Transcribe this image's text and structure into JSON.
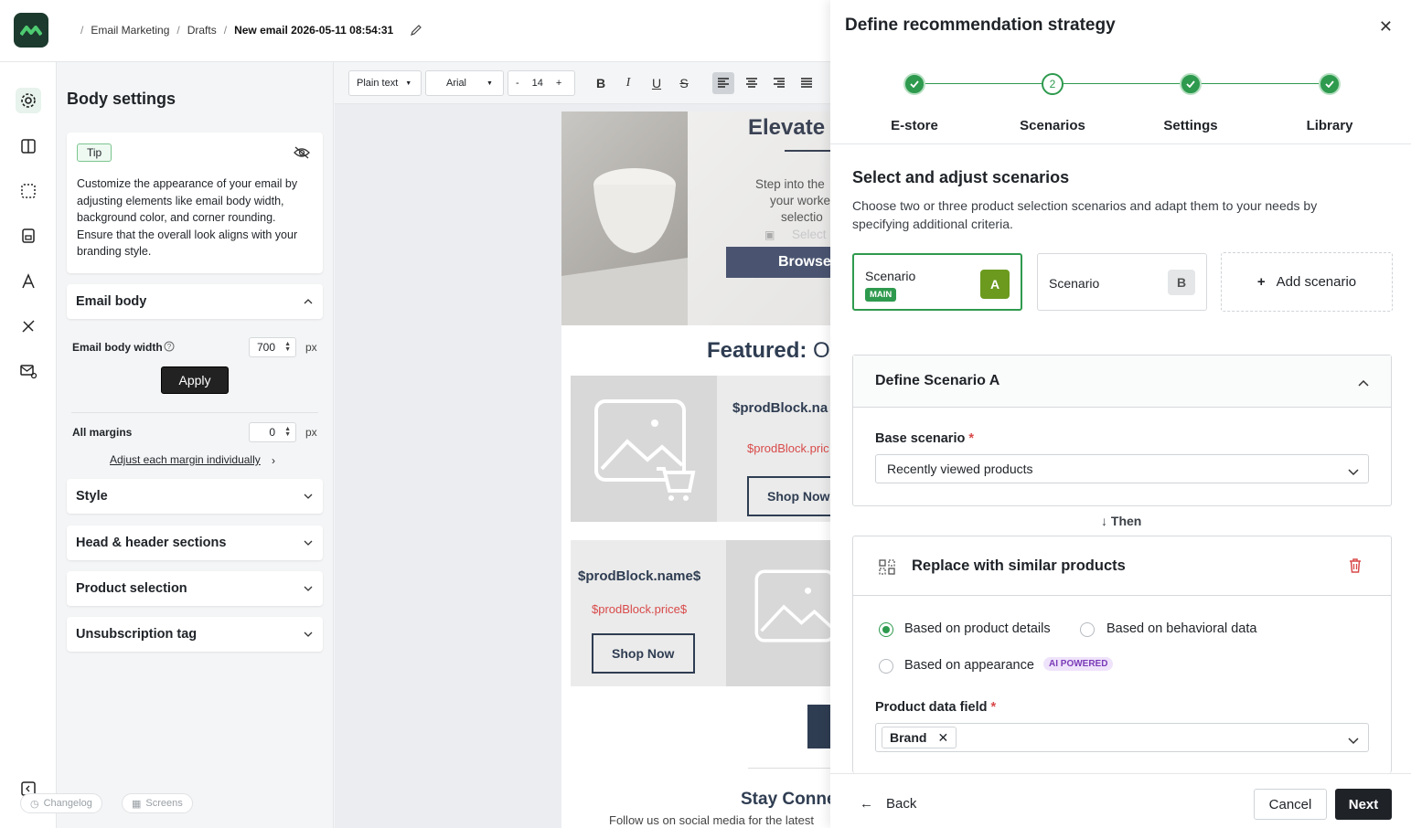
{
  "breadcrumb": {
    "root": "Email Marketing",
    "folder": "Drafts",
    "current": "New email 2026-05-11 08:54:31"
  },
  "settings": {
    "title": "Body settings",
    "tip_badge": "Tip",
    "tip_text": "Customize the appearance of your email by adjusting elements like email body width, background color, and corner rounding. Ensure that the overall look aligns with your branding style.",
    "email_body": "Email body",
    "email_body_width_label": "Email body width",
    "email_body_width_value": "700",
    "unit": "px",
    "apply": "Apply",
    "all_margins_label": "All margins",
    "all_margins_value": "0",
    "adjust_link": "Adjust each margin individually",
    "sections": [
      "Style",
      "Head & header sections",
      "Product selection",
      "Unsubscription tag"
    ],
    "footer_changelog": "Changelog",
    "footer_screens": "Screens"
  },
  "toolbar": {
    "text_type": "Plain text",
    "font": "Arial",
    "size_minus": "-",
    "size": "14",
    "size_plus": "+"
  },
  "email": {
    "hero_title": "Elevate",
    "hero_lines": [
      "Step into the",
      "your worke",
      "selectio",
      "Select"
    ],
    "browse": "Browse",
    "featured_bold": "Featured:",
    "featured_rest": " Ou",
    "prod1_name": "$prodBlock.na",
    "prod1_price": "$prodBlock.pric",
    "prod1_shop": "Shop Now",
    "prod2_name": "$prodBlock.name$",
    "prod2_price": "$prodBlock.price$",
    "prod2_shop": "Shop Now",
    "stay": "Stay Conne",
    "follow": "Follow us on social media for the latest"
  },
  "modal": {
    "title": "Define recommendation strategy",
    "steps": [
      {
        "label": "E-store",
        "state": "done"
      },
      {
        "label": "Scenarios",
        "state": "current",
        "number": "2"
      },
      {
        "label": "Settings",
        "state": "done"
      },
      {
        "label": "Library",
        "state": "done"
      }
    ],
    "section_title": "Select and adjust scenarios",
    "section_desc": "Choose two or three product selection scenarios and adapt them to your needs by specifying additional criteria.",
    "scenario_a": {
      "label": "Scenario",
      "badge": "MAIN",
      "letter": "A"
    },
    "scenario_b": {
      "label": "Scenario",
      "letter": "B"
    },
    "add_scenario": "Add scenario",
    "define_title": "Define Scenario A",
    "base_label": "Base scenario",
    "base_value": "Recently viewed products",
    "then": "Then",
    "replace_title": "Replace with similar products",
    "radio_product_details": "Based on product details",
    "radio_behavioral": "Based on behavioral data",
    "radio_appearance": "Based on appearance",
    "ai_badge": "AI POWERED",
    "data_field_label": "Product data field",
    "data_field_chip": "Brand",
    "back": "Back",
    "cancel": "Cancel",
    "next": "Next"
  },
  "colors": {
    "accent": "#2e9a4e",
    "dark": "#1f2328",
    "danger": "#d94a4a",
    "scenario_a": "#6b9a1e"
  }
}
